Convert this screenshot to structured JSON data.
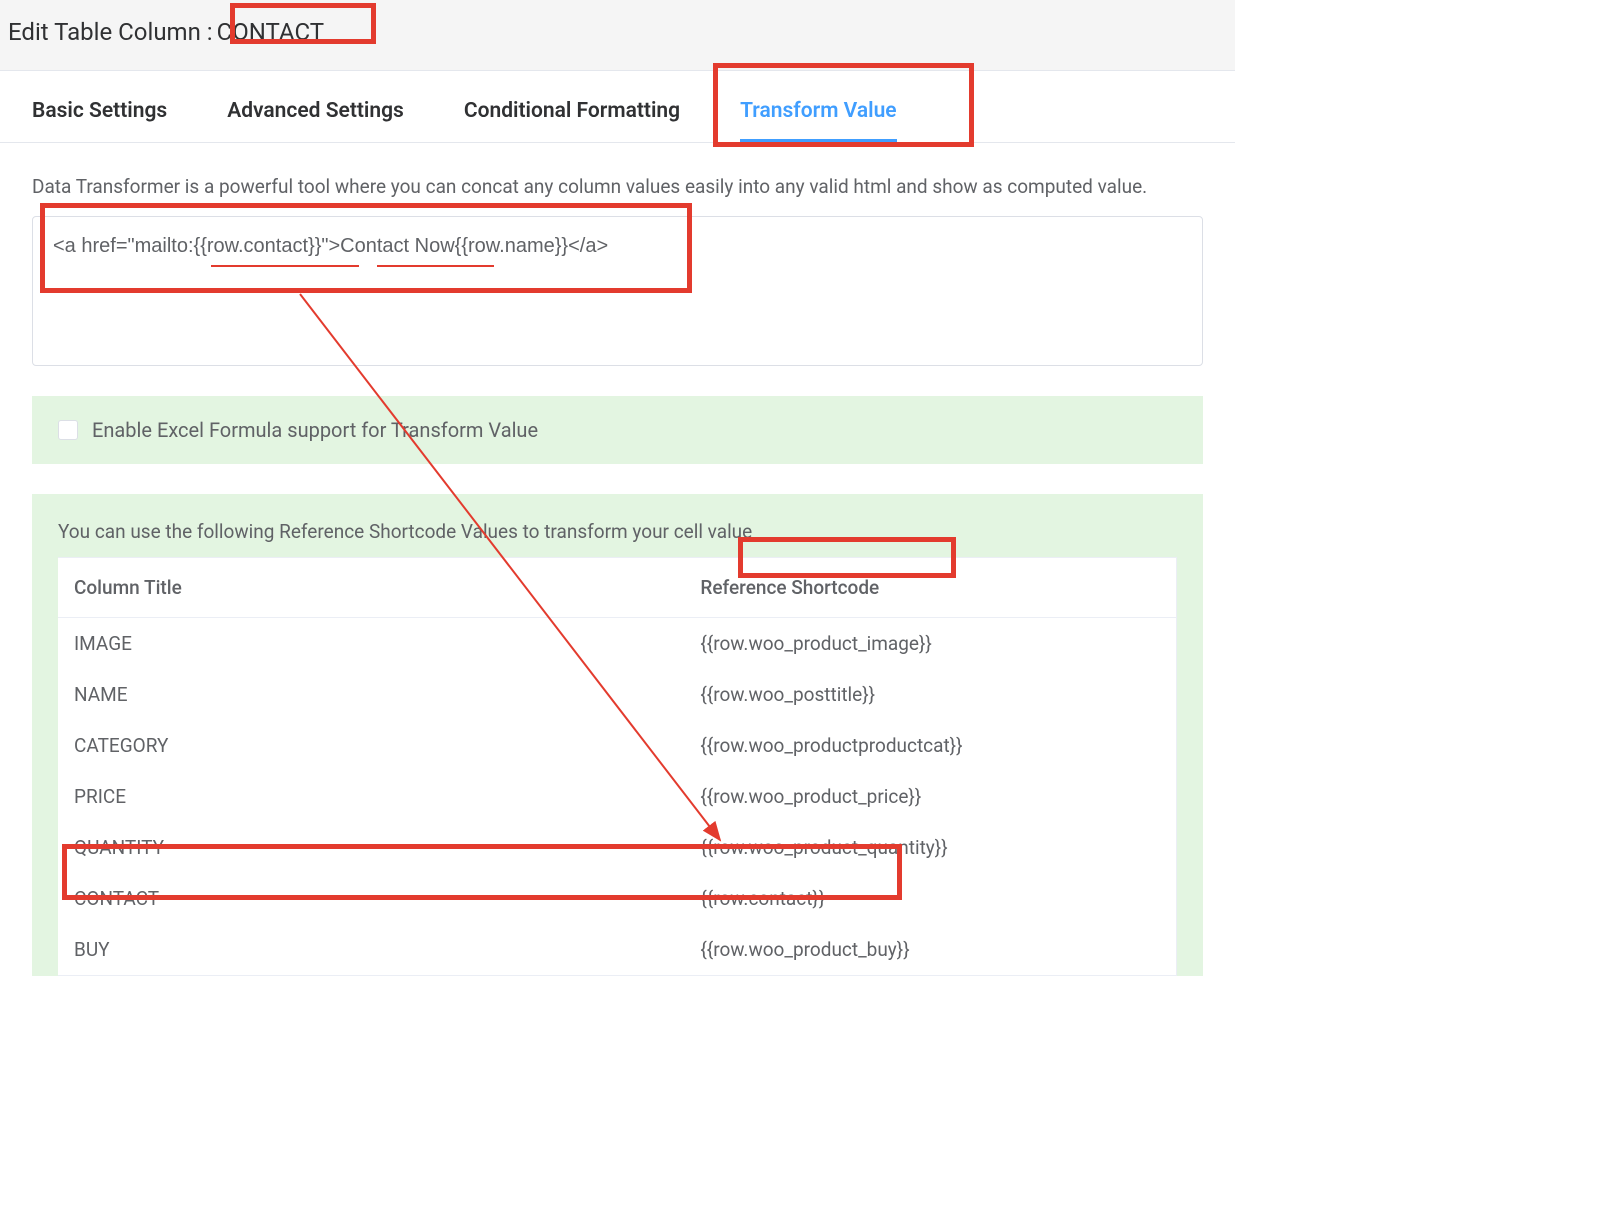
{
  "header": {
    "prefix": "Edit Table Column :",
    "column_name": "CONTACT"
  },
  "tabs": [
    {
      "label": "Basic Settings",
      "active": false
    },
    {
      "label": "Advanced Settings",
      "active": false
    },
    {
      "label": "Conditional Formatting",
      "active": false
    },
    {
      "label": "Transform Value",
      "active": true
    }
  ],
  "description": "Data Transformer is a powerful tool where you can concat any column values easily into any valid html and show as computed value.",
  "transform_value": "<a href=\"mailto:{{row.contact}}\">Contact Now{{row.name}}</a>",
  "formula_checkbox_label": "Enable Excel Formula support for Transform Value",
  "reference_intro": "You can use the following Reference Shortcode Values to transform your cell value",
  "table_headers": {
    "col1": "Column Title",
    "col2": "Reference Shortcode"
  },
  "shortcodes": [
    {
      "title": "IMAGE",
      "code": "{{row.woo_product_image}}"
    },
    {
      "title": "NAME",
      "code": "{{row.woo_posttitle}}"
    },
    {
      "title": "CATEGORY",
      "code": "{{row.woo_productproductcat}}"
    },
    {
      "title": "PRICE",
      "code": "{{row.woo_product_price}}"
    },
    {
      "title": "QUANTITY",
      "code": "{{row.woo_product_quantity}}"
    },
    {
      "title": "CONTACT",
      "code": "{{row.contact}}"
    },
    {
      "title": "BUY",
      "code": "{{row.woo_product_buy}}"
    }
  ]
}
